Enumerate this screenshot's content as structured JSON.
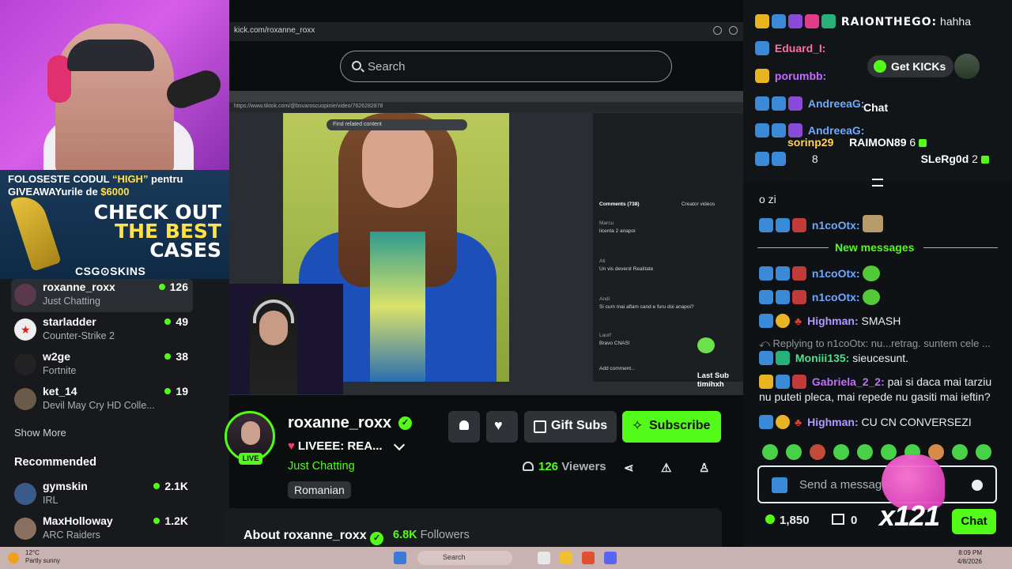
{
  "colors": {
    "accent": "#53fc18",
    "background": "#0b0e0f",
    "surface": "#2f3337"
  },
  "webcam_ad": {
    "line1_a": "FOLOSESTE CODUL ",
    "line1_code": "“HIGH”",
    "line1_b": " pentru",
    "line2_a": "GIVEAWAYurile de ",
    "line2_amount": "$6000",
    "headline": [
      "CHECK OUT",
      "THE BEST",
      "CASES"
    ],
    "brand": "CSG⊙SKINS"
  },
  "sidebar": {
    "following": [
      {
        "name": "roxanne_roxx",
        "category": "Just Chatting",
        "viewers": "126"
      },
      {
        "name": "starladder",
        "category": "Counter-Strike 2",
        "viewers": "49"
      },
      {
        "name": "w2ge",
        "category": "Fortnite",
        "viewers": "38"
      },
      {
        "name": "ket_14",
        "category": "Devil May Cry HD Colle...",
        "viewers": "19"
      }
    ],
    "show_more": "Show More",
    "recommended_title": "Recommended",
    "recommended": [
      {
        "name": "gymskin",
        "category": "IRL",
        "viewers": "2.1K"
      },
      {
        "name": "MaxHolloway",
        "category": "ARC Raiders",
        "viewers": "1.2K"
      }
    ]
  },
  "browser": {
    "url": "kick.com/roxanne_roxx"
  },
  "search": {
    "placeholder": "Search"
  },
  "video": {
    "inner_url": "https://www.tiktok.com/@bsvaroscuopinie/video/7626282878",
    "find_related": "Find related content",
    "comments_tab": "Comments (738)",
    "creator_videos": "Creator videos",
    "comments": [
      {
        "user": "Marcu",
        "text": "licenta 2 anapoi"
      },
      {
        "user": "Ati",
        "text": "Un vis devenit Realitate"
      },
      {
        "user": "Andi",
        "text": "Si cum mai aflam cand e furu doi anapoi?"
      },
      {
        "user": "Laurf",
        "text": "Bravo CNAS!"
      }
    ],
    "add_comment": "Add comment...",
    "last_sub_label": "Last Sub",
    "last_sub_user": "timihxh"
  },
  "channel": {
    "name": "roxanne_roxx",
    "title": "LIVEEE: REA...",
    "category": "Just Chatting",
    "language": "Romanian",
    "live_label": "LIVE",
    "viewers_count": "126",
    "viewers_label": "Viewers",
    "gift_label": "Gift Subs",
    "subscribe_label": "Subscribe",
    "about_label": "About roxanne_roxx",
    "followers_count": "6.8K",
    "followers_label": "Followers"
  },
  "chat": {
    "get_kicks": "Get KICKs",
    "chat_label": "Chat",
    "top_messages": [
      {
        "user": "RAIONTHEGO:",
        "text": "hahha"
      },
      {
        "user": "Eduard_I:",
        "text": ""
      },
      {
        "user": "porumbb:",
        "text": ""
      },
      {
        "user": "AndreeaG:",
        "text": ""
      },
      {
        "user": "AndreeaG:",
        "text": ""
      }
    ],
    "leaderboard": [
      {
        "name": "sorinp29",
        "count": ""
      },
      {
        "name": "RAIMON89",
        "count": "6"
      },
      {
        "name": "SLeRg0d",
        "count": "2"
      }
    ],
    "lead_prefix": "8",
    "message_o_zi": "o zi",
    "new_messages": "New messages",
    "messages": [
      {
        "user": "n1coOtx:",
        "text": ""
      },
      {
        "user": "n1coOtx:",
        "text": ""
      },
      {
        "user": "n1coOtx:",
        "text": ""
      },
      {
        "user": "Highman:",
        "text": "SMASH"
      },
      {
        "user": "Moniii135:",
        "text": "sieucesunt."
      },
      {
        "user": "Gabriela_2_2:",
        "text": "pai si daca mai tarziu"
      },
      {
        "user": "",
        "text": "nu puteti pleca, mai repede nu gasiti mai ieftin?"
      },
      {
        "user": "Highman:",
        "text": "CU CN CONVERSEZI"
      }
    ],
    "reply_text": "Replying to n1coOtx: nu...retrag. suntem cele ...",
    "input_placeholder": "Send a message",
    "points": "1,850",
    "drops": "0",
    "combo": "x121",
    "send_label": "Chat"
  },
  "taskbar": {
    "temp": "12°C",
    "weather": "Partly sunny",
    "search": "Search",
    "time": "8:09 PM",
    "date": "4/8/2026"
  }
}
